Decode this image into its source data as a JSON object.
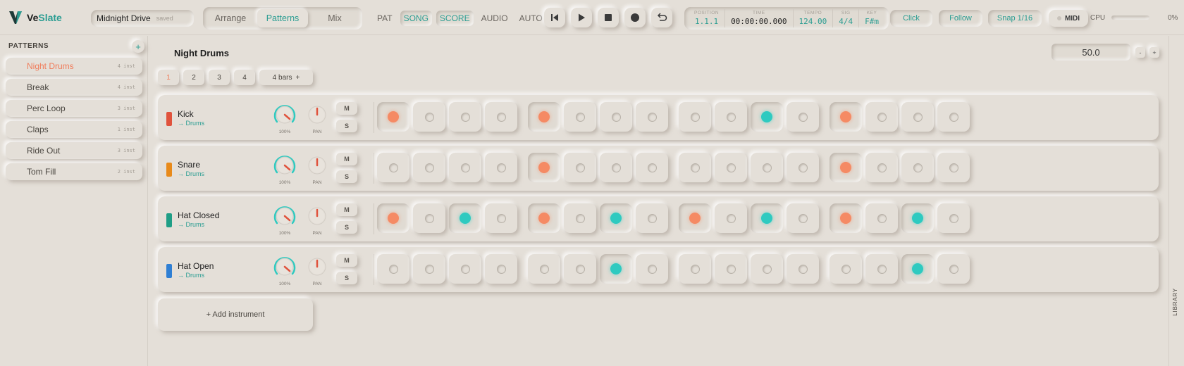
{
  "app": {
    "name_prefix": "Ve",
    "name_suffix": "Slate",
    "brand_color": "#2a9d92"
  },
  "project": {
    "name": "Midnight Drive",
    "status": "saved"
  },
  "view_tabs": [
    {
      "label": "Arrange",
      "active": false
    },
    {
      "label": "Patterns",
      "active": true
    },
    {
      "label": "Mix",
      "active": false
    }
  ],
  "modes": [
    {
      "label": "PAT",
      "on": false
    },
    {
      "label": "SONG",
      "on": true
    },
    {
      "label": "SCORE",
      "on": true
    },
    {
      "label": "AUDIO",
      "on": false
    },
    {
      "label": "AUTO",
      "on": false
    }
  ],
  "transport": {
    "buttons": [
      "skip-back-icon",
      "play-icon",
      "stop-icon",
      "record-icon",
      "loop-icon"
    ]
  },
  "display": {
    "position_label": "POSITION",
    "position": "1.1.1",
    "time_label": "TIME",
    "time": "00:00:00.000",
    "tempo_label": "TEMPO",
    "tempo": "124.00",
    "sig_label": "SIG",
    "sig": "4/4",
    "key_label": "KEY",
    "key": "F#m"
  },
  "toolbar": {
    "click": "Click",
    "follow": "Follow",
    "snap": "Snap 1/16",
    "midi": "MIDI",
    "cpu_label": "CPU",
    "cpu_value": "0%",
    "cpu_fraction": 0
  },
  "sidebar": {
    "title": "PATTERNS",
    "add": "+",
    "items": [
      {
        "name": "Night Drums",
        "count": "4 inst",
        "active": true
      },
      {
        "name": "Break",
        "count": "4 inst",
        "active": false
      },
      {
        "name": "Perc Loop",
        "count": "3 inst",
        "active": false
      },
      {
        "name": "Claps",
        "count": "1 inst",
        "active": false
      },
      {
        "name": "Ride Out",
        "count": "3 inst",
        "active": false
      },
      {
        "name": "Tom Fill",
        "count": "2 inst",
        "active": false
      }
    ]
  },
  "pattern": {
    "title": "Night Drums",
    "zoom": "50.0",
    "zoom_minus": "-",
    "zoom_plus": "+",
    "tabs": [
      "1",
      "2",
      "3",
      "4"
    ],
    "active_tab": 0,
    "length": "4 bars",
    "length_add": "+"
  },
  "channels": [
    {
      "name": "Kick",
      "route": "→ Drums",
      "color": "#e0533d",
      "volume": "100%",
      "pan_label": "PAN",
      "mute": "M",
      "solo": "S",
      "steps": [
        "c",
        "",
        "",
        "",
        "c",
        "",
        "",
        "",
        "",
        "",
        "t",
        "",
        "c",
        "",
        "",
        ""
      ]
    },
    {
      "name": "Snare",
      "route": "→ Drums",
      "color": "#e88a1a",
      "volume": "100%",
      "pan_label": "PAN",
      "mute": "M",
      "solo": "S",
      "steps": [
        "",
        "",
        "",
        "",
        "c",
        "",
        "",
        "",
        "",
        "",
        "",
        "",
        "c",
        "",
        "",
        ""
      ]
    },
    {
      "name": "Hat Closed",
      "route": "→ Drums",
      "color": "#1f9e86",
      "volume": "100%",
      "pan_label": "PAN",
      "mute": "M",
      "solo": "S",
      "steps": [
        "c",
        "",
        "t",
        "",
        "c",
        "",
        "t",
        "",
        "c",
        "",
        "t",
        "",
        "c",
        "",
        "t",
        ""
      ]
    },
    {
      "name": "Hat Open",
      "route": "→ Drums",
      "color": "#2f7fd4",
      "volume": "100%",
      "pan_label": "PAN",
      "mute": "M",
      "solo": "S",
      "steps": [
        "",
        "",
        "",
        "",
        "",
        "",
        "t",
        "",
        "",
        "",
        "",
        "",
        "",
        "",
        "t",
        ""
      ]
    }
  ],
  "add_instrument": "+  Add instrument",
  "right_rail": {
    "label": "LIBRARY"
  }
}
